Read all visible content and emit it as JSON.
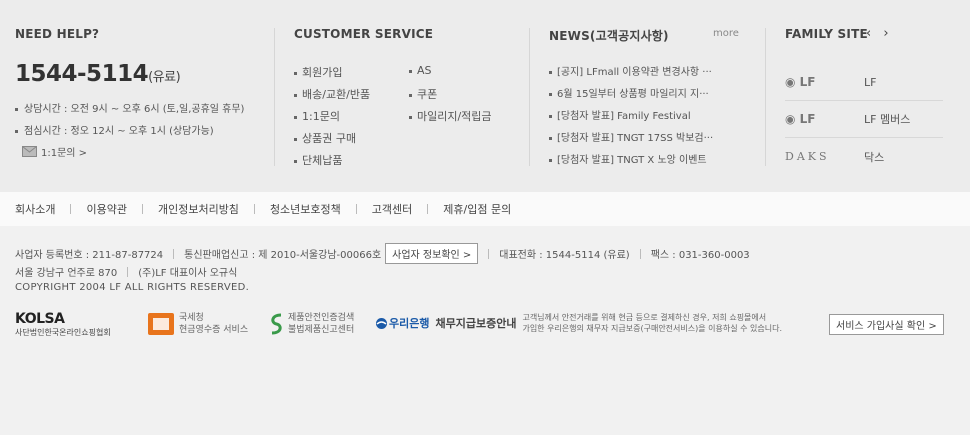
{
  "help": {
    "title": "NEED HELP?",
    "phone": "1544-5114",
    "phone_suffix": "(유료)",
    "hours_consult": "상담시간 : 오전 9시 ~ 오후 6시 (토,일,공휴일 휴무)",
    "hours_lunch": "점심시간 : 정오 12시 ~ 오후 1시 (상담가능)",
    "inquiry_label": "1:1문의 >"
  },
  "customer_service": {
    "title": "CUSTOMER SERVICE",
    "items_left": [
      "회원가입",
      "배송/교환/반품",
      "1:1문의",
      "상품권 구매",
      "단체납품"
    ],
    "items_right": [
      "AS",
      "쿠폰",
      "마일리지/적립금"
    ]
  },
  "news": {
    "title": "NEWS(고객공지사항)",
    "more_label": "more",
    "items": [
      "[공지] LFmall 이용약관 변경사항 ···",
      "6월 15일부터 상품평 마일리지 지···",
      "[당첨자 발표] Family Festival",
      "[당첨자 발표] TNGT 17SS 박보검···",
      "[당첨자 발표] TNGT X 노앙 이벤트"
    ]
  },
  "family": {
    "title": "FAMILY SITE",
    "prev_icon": "‹",
    "next_icon": "›",
    "sites": [
      {
        "logo": "LF",
        "name": "LF"
      },
      {
        "logo": "LF",
        "name": "LF 멤버스"
      },
      {
        "logo": "DAKS",
        "name": "닥스"
      }
    ]
  },
  "links": [
    "회사소개",
    "이용약관",
    "개인정보처리방침",
    "청소년보호정책",
    "고객센터",
    "제휴/입점 문의"
  ],
  "company": {
    "biz_no": "사업자 등록번호 : 211-87-87724",
    "ecommerce_no": "통신판매업신고 : 제 2010-서울강남-00066호",
    "biz_info_button": "사업자 정보확인 >",
    "tel": "대표전화 : 1544-5114 (유료)",
    "fax": "팩스 : 031-360-0003",
    "address": "서울 강남구 언주로 870",
    "ceo": "(주)LF 대표이사 오규식",
    "copyright": "COPYRIGHT 2004 LF ALL RIGHTS RESERVED."
  },
  "certs": {
    "kolsa_title": "KOLSA",
    "kolsa_sub": "사단법인한국온라인쇼핑협회",
    "nts_line1": "국세청",
    "nts_line2": "현금영수증 서비스",
    "safety_line1": "제품안전인증검색",
    "safety_line2": "불법제품신고센터",
    "woori_logo": "우리은행",
    "woori_title": "채무지급보증안내",
    "woori_desc1": "고객님께서 안전거래를 위해 현금 등으로 결제하신 경우, 저희 쇼핑몰에서",
    "woori_desc2": "가입한 우리은행의 채무자 지급보증(구매안전서비스)을 이용하실 수 있습니다.",
    "service_button": "서비스 가입사실 확인 >"
  },
  "colors": {
    "woori_blue": "#1b5aa8",
    "nts_orange": "#e8741c",
    "safety_green": "#3a9a4a"
  }
}
